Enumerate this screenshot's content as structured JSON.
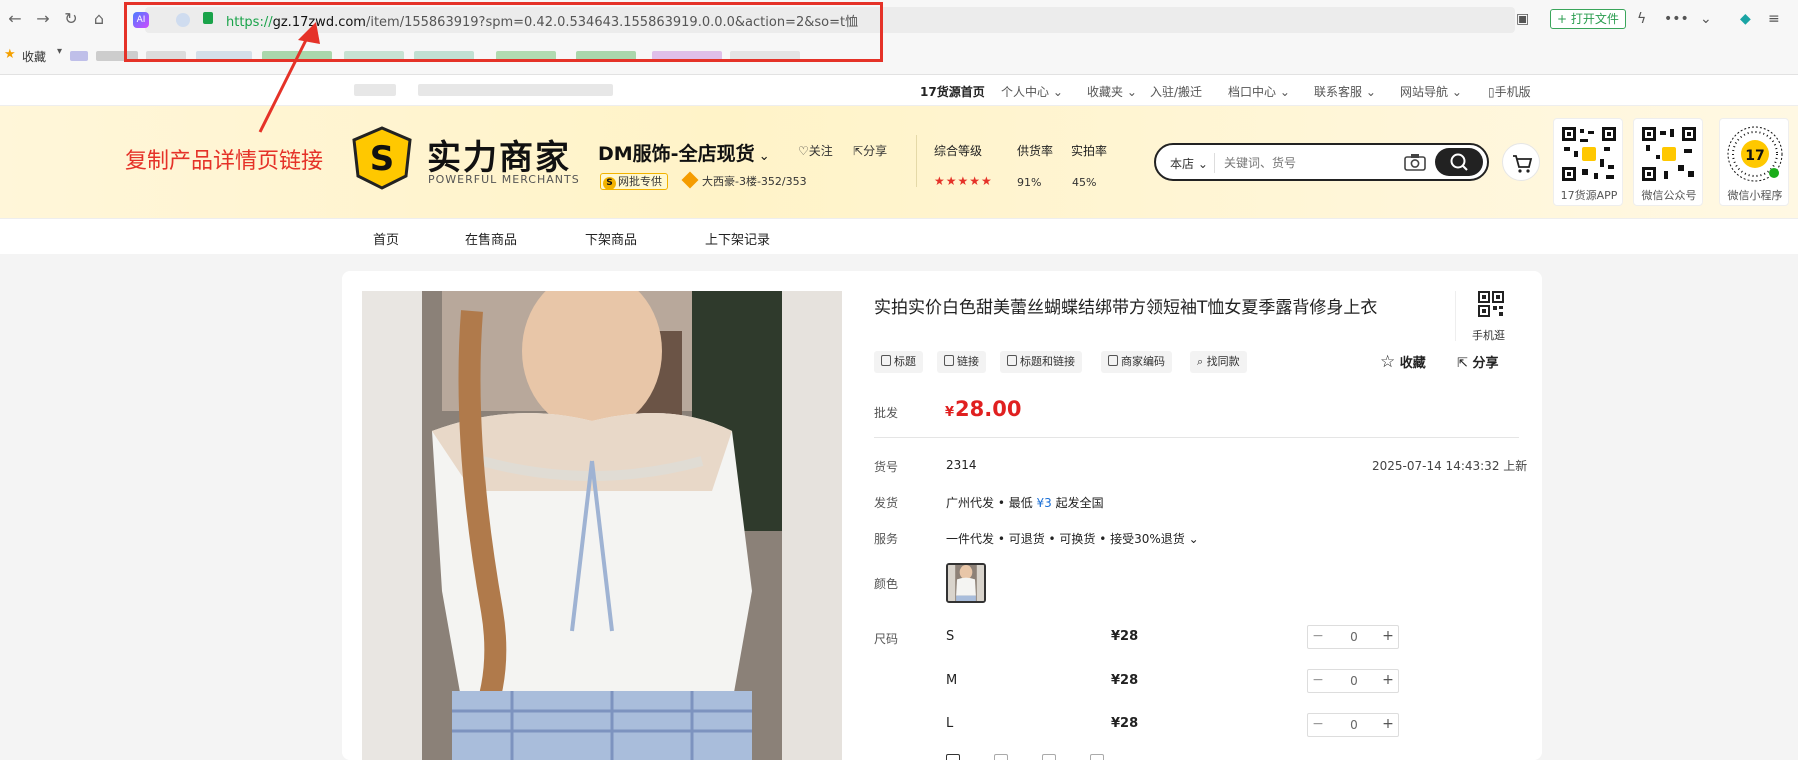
{
  "browser": {
    "url_proto": "https://",
    "url_host": "gz.17zwd.com",
    "url_path": "/item/155863919?spm=0.42.0.534643.155863919.0.0.0&action=2&so=t恤",
    "open_file_label": "打开文件",
    "bookmarks_label": "收藏",
    "ai_badge": "AI"
  },
  "annotation": {
    "text": "复制产品详情页链接",
    "color": "#e53228"
  },
  "topbar": {
    "links": [
      "17货源首页",
      "个人中心",
      "收藏夹",
      "入驻/搬迁",
      "档口中心",
      "联系客服",
      "网站导航",
      "手机版"
    ]
  },
  "header": {
    "logo_title": "实力商家",
    "logo_sub": "POWERFUL MERCHANTS",
    "logo_letter": "S",
    "shop_name": "DM服饰-全店现货",
    "follow_label": "关注",
    "share_label": "分享",
    "tag_label": "网批专供",
    "location": "大西豪-3楼-352/353",
    "stats": {
      "rating_label": "综合等级",
      "rating_stars": 5,
      "supply_label": "供货率",
      "supply_value": "91%",
      "real_label": "实拍率",
      "real_value": "45%"
    },
    "search": {
      "scope": "本店",
      "placeholder": "关键词、货号"
    },
    "qr_cards": [
      {
        "caption": "17货源APP"
      },
      {
        "caption": "微信公众号"
      },
      {
        "caption": "微信小程序"
      }
    ]
  },
  "shopnav": {
    "items": [
      "首页",
      "在售商品",
      "下架商品",
      "上下架记录"
    ]
  },
  "product": {
    "title": "实拍实价白色甜美蕾丝蝴蝶结绑带方领短袖T恤女夏季露背修身上衣",
    "qr_caption": "手机逛",
    "copy_chips": [
      "标题",
      "链接",
      "标题和链接",
      "商家编码",
      "找同款"
    ],
    "favorite_label": "收藏",
    "share_label": "分享",
    "price_label": "批发",
    "price_symbol": "¥",
    "price": "28.00",
    "code_label": "货号",
    "code": "2314",
    "date": "2025-07-14 14:43:32 上新",
    "ship_label": "发货",
    "ship_prefix": "广州代发 • 最低 ",
    "ship_price": "¥3",
    "ship_suffix": " 起发全国",
    "service_label": "服务",
    "service": "一件代发 • 可退货 • 可换货 • 接受30%退货",
    "color_label": "颜色",
    "size_label": "尺码",
    "sizes": [
      {
        "size": "S",
        "price": "¥28",
        "qty": "0"
      },
      {
        "size": "M",
        "price": "¥28",
        "qty": "0"
      },
      {
        "size": "L",
        "price": "¥28",
        "qty": "0"
      }
    ]
  }
}
